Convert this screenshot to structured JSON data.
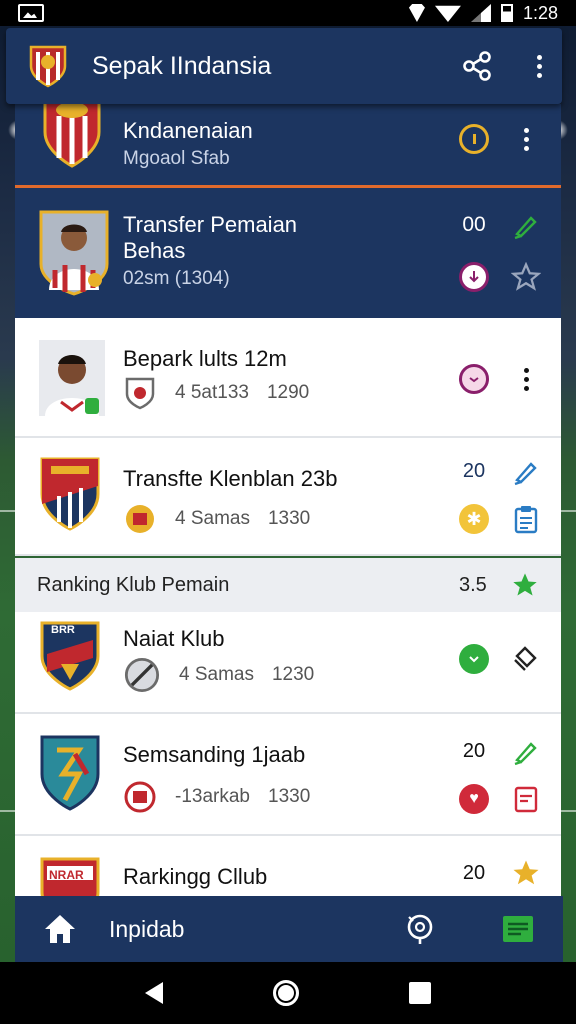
{
  "status_bar": {
    "time": "1:28"
  },
  "app_bar": {
    "title": "Sepak IIndansia"
  },
  "colors": {
    "navy": "#1c3560",
    "accent_orange": "#e06a2c",
    "green": "#2fae3e",
    "gold": "#e8b12a",
    "purple": "#8a1f6b",
    "red": "#d02a3a"
  },
  "cards": [
    {
      "title": "Kndanenaian",
      "subtitle": "Mgoaol Sfab"
    },
    {
      "title": "Transfer Pemaian",
      "title2": "Behas",
      "subtitle": "02sm (1304)",
      "value": "00"
    },
    {
      "title": "Bepark lults 12m",
      "stat1": "4 5at133",
      "stat2": "1290"
    },
    {
      "title": "Transfte Klenblan 23b",
      "stat1": "4 Samas",
      "stat2": "1330",
      "value": "20"
    }
  ],
  "section": {
    "title": "Ranking Klub Pemain",
    "value": "3.5"
  },
  "clubs": [
    {
      "title": "Naiat Klub",
      "stat1": "4 Samas",
      "stat2": "1230"
    },
    {
      "title": "Semsanding 1jaab",
      "stat1": "-13arkab",
      "stat2": "1330",
      "value": "20"
    },
    {
      "title": "Rarkingg Cllub",
      "value": "20"
    }
  ],
  "crest_text": {
    "club_a": "BRR",
    "club_b": "NRAR"
  },
  "bottom_nav": {
    "label": "Inpidab"
  },
  "icons": [
    "share-icon",
    "more-vert-icon",
    "home-icon",
    "search-badge-icon",
    "list-icon",
    "star-icon",
    "pencil-icon",
    "clipboard-icon"
  ]
}
